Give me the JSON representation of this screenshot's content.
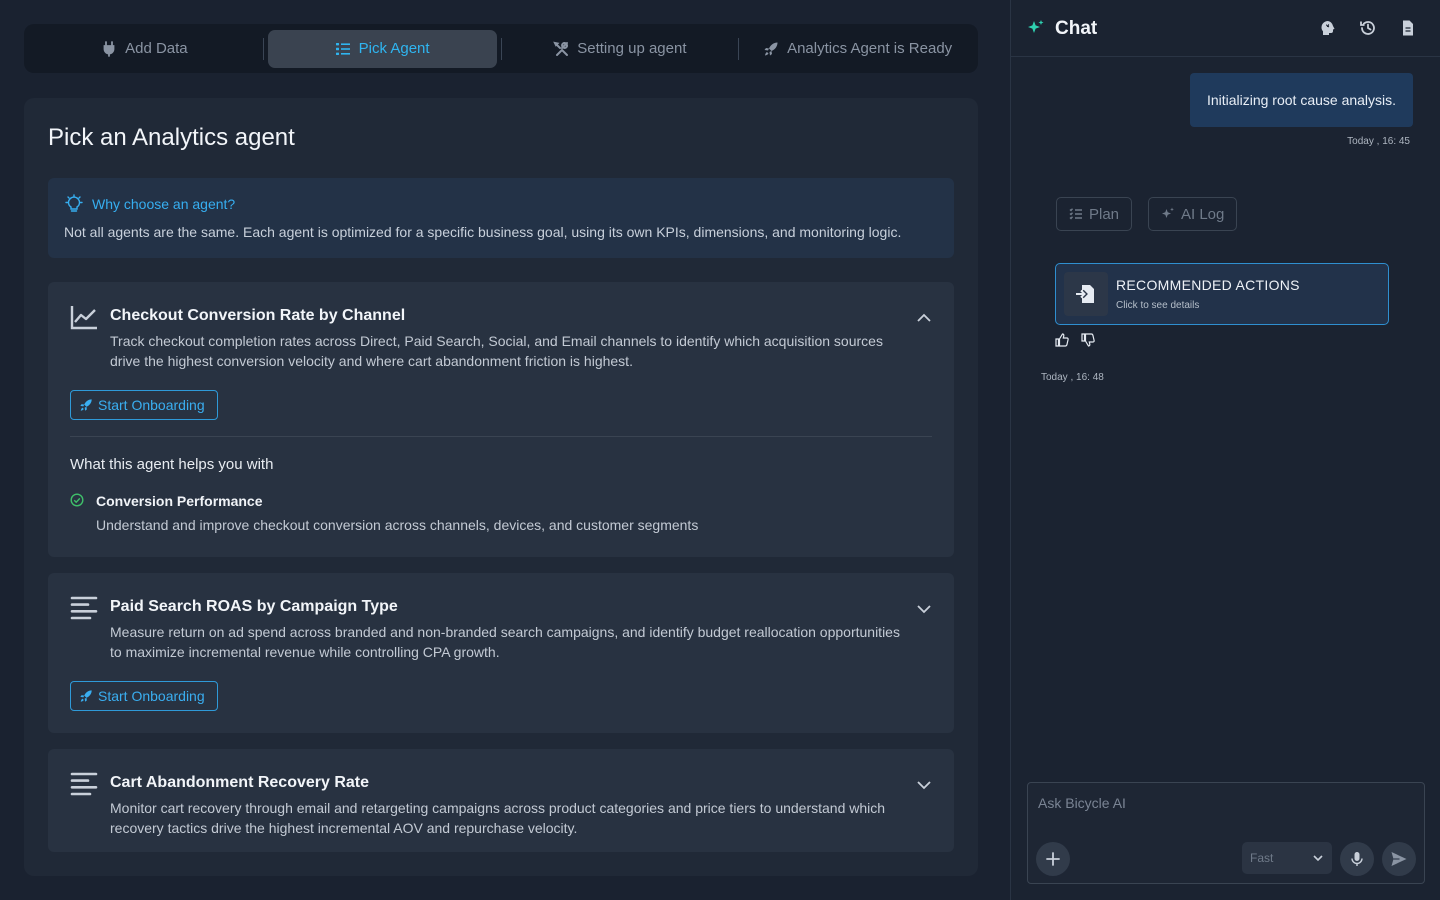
{
  "stepper": {
    "steps": [
      {
        "label": "Add Data",
        "icon": "plug-icon"
      },
      {
        "label": "Pick Agent",
        "icon": "list-icon"
      },
      {
        "label": "Setting up agent",
        "icon": "tools-icon"
      },
      {
        "label": "Analytics Agent is Ready",
        "icon": "rocket-icon"
      }
    ],
    "active_index": 1
  },
  "main": {
    "title": "Pick an Analytics agent",
    "why": {
      "heading": "Why choose an agent?",
      "text": "Not all agents are the same. Each agent is optimized for a specific business goal, using its own KPIs, dimensions, and monitoring logic."
    },
    "agents": [
      {
        "title": "Checkout Conversion Rate by Channel",
        "description": "Track checkout completion rates across Direct, Paid Search, Social, and Email channels to identify which acquisition sources drive the highest conversion velocity and where cart abandonment friction is highest.",
        "button": "Start Onboarding",
        "expanded": true,
        "helps_title": "What this agent helps you with",
        "helps": [
          {
            "title": "Conversion Performance",
            "description": "Understand and improve checkout conversion across channels, devices, and customer segments"
          }
        ]
      },
      {
        "title": "Paid Search ROAS by Campaign Type",
        "description": "Measure return on ad spend across branded and non-branded search campaigns, and identify budget reallocation opportunities to maximize incremental revenue while controlling CPA growth.",
        "button": "Start Onboarding",
        "expanded": false
      },
      {
        "title": "Cart Abandonment Recovery Rate",
        "description": "Monitor cart recovery through email and retargeting campaigns across product categories and price tiers to understand which recovery tactics drive the highest incremental AOV and repurchase velocity.",
        "expanded": false
      }
    ]
  },
  "chat": {
    "title": "Chat",
    "messages": [
      {
        "text": "Initializing root cause analysis.",
        "time": "Today , 16: 45"
      }
    ],
    "pills": [
      "Plan",
      "AI Log"
    ],
    "recommended": {
      "title": "RECOMMENDED ACTIONS",
      "subtitle": "Click to see details"
    },
    "response_time": "Today , 16: 48",
    "input_placeholder": "Ask Bicycle AI",
    "mode": "Fast"
  },
  "colors": {
    "accent": "#2fb5f0",
    "success": "#3fbf6a",
    "background": "#1a2230"
  }
}
